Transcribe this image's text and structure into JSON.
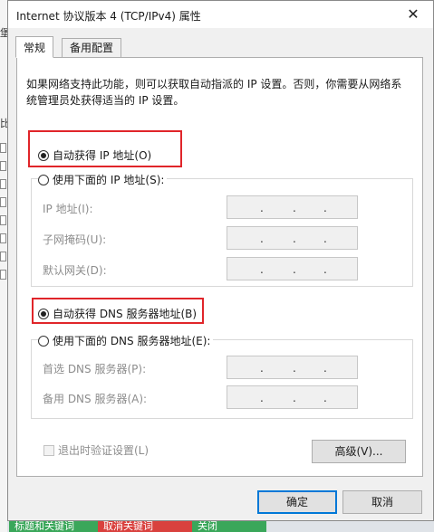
{
  "background": {
    "side_chars": [
      "堡",
      "比"
    ],
    "bottom_buttons": [
      {
        "label": "标题和关键词",
        "color": "#3aa75a"
      },
      {
        "label": "取消关键词",
        "color": "#d9413e"
      },
      {
        "label": "关闭",
        "color": "#3aa75a"
      }
    ]
  },
  "dialog": {
    "title": "Internet 协议版本 4 (TCP/IPv4) 属性",
    "close_glyph": "✕"
  },
  "tabs": [
    {
      "label": "常规",
      "active": true
    },
    {
      "label": "备用配置",
      "active": false
    }
  ],
  "description": "如果网络支持此功能，则可以获取自动指派的 IP 设置。否则，你需要从网络系统管理员处获得适当的 IP 设置。",
  "ip": {
    "auto_label": "自动获得 IP 地址(O)",
    "manual_label": "使用下面的 IP 地址(S):",
    "fields": [
      {
        "label": "IP 地址(I):"
      },
      {
        "label": "子网掩码(U):"
      },
      {
        "label": "默认网关(D):"
      }
    ]
  },
  "dns": {
    "auto_label": "自动获得 DNS 服务器地址(B)",
    "manual_label": "使用下面的 DNS 服务器地址(E):",
    "fields": [
      {
        "label": "首选 DNS 服务器(P):"
      },
      {
        "label": "备用 DNS 服务器(A):"
      }
    ]
  },
  "validate_label": "退出时验证设置(L)",
  "buttons": {
    "advanced": "高级(V)...",
    "ok": "确定",
    "cancel": "取消"
  },
  "colors": {
    "highlight": "#e0252a",
    "default_button_border": "#0078d7"
  }
}
